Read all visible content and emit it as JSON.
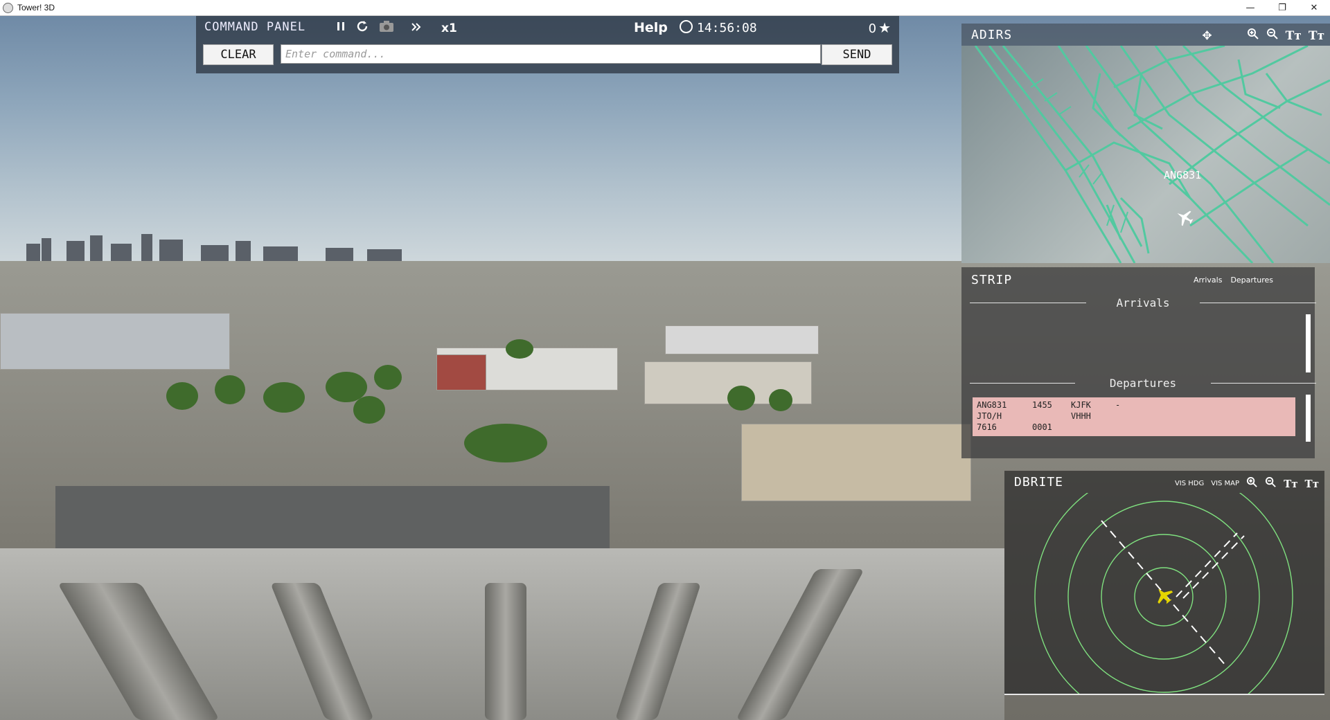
{
  "window": {
    "title": "Tower! 3D",
    "minimize": "—",
    "restore": "❐",
    "close": "✕"
  },
  "command_panel": {
    "title": "COMMAND PANEL",
    "pause_icon": "pause-icon",
    "refresh_icon": "refresh-icon",
    "camera_icon": "camera-icon",
    "fast_forward_icon": "fast-forward-icon",
    "speed": "x1",
    "help": "Help",
    "time": "14:56:08",
    "score": "0",
    "clear_label": "CLEAR",
    "input_placeholder": "Enter command...",
    "send_label": "SEND"
  },
  "adirs": {
    "title": "ADIRS",
    "aircraft_label": "ANG831",
    "map_color": "#52c9a0"
  },
  "strip": {
    "title": "STRIP",
    "tab_arrivals": "Arrivals",
    "tab_departures": "Departures",
    "arrivals_header": "Arrivals",
    "departures_header": "Departures",
    "departure_row": {
      "callsign": "ANG831",
      "time": "1455",
      "origin": "KJFK",
      "remark": "-",
      "type": "JTO/H",
      "destination": "VHHH",
      "squawk": "7616",
      "code": "0001"
    },
    "strip_color": "#e9b9b7"
  },
  "dbrite": {
    "title": "DBRITE",
    "vis_hdg": "VIS HDG",
    "vis_map": "VIS MAP",
    "ring_color": "#7fe07f",
    "target_color": "#e5d500"
  }
}
